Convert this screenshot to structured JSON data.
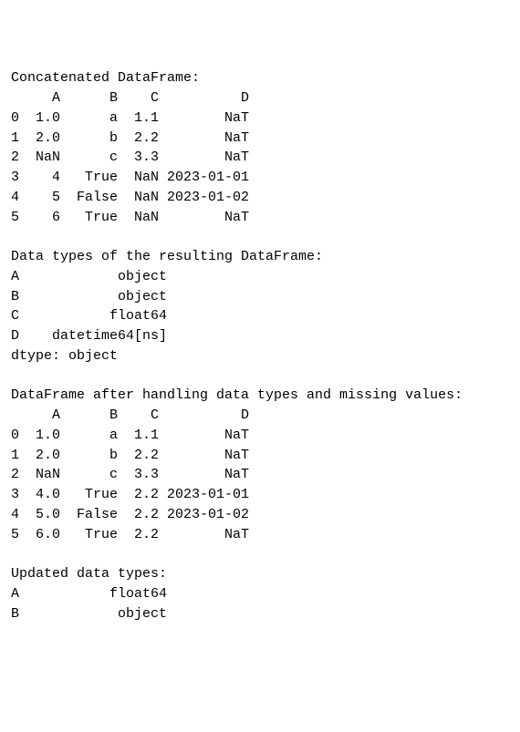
{
  "section1": {
    "title": "Concatenated DataFrame:",
    "header": "     A      B    C          D",
    "rows": [
      "0  1.0      a  1.1        NaT",
      "1  2.0      b  2.2        NaT",
      "2  NaN      c  3.3        NaT",
      "3    4   True  NaN 2023-01-01",
      "4    5  False  NaN 2023-01-02",
      "5    6   True  NaN        NaT"
    ]
  },
  "section2": {
    "title": "Data types of the resulting DataFrame:",
    "rows": [
      "A            object",
      "B            object",
      "C           float64",
      "D    datetime64[ns]",
      "dtype: object"
    ]
  },
  "section3": {
    "title": "DataFrame after handling data types and missing values:",
    "header": "     A      B    C          D",
    "rows": [
      "0  1.0      a  1.1        NaT",
      "1  2.0      b  2.2        NaT",
      "2  NaN      c  3.3        NaT",
      "3  4.0   True  2.2 2023-01-01",
      "4  5.0  False  2.2 2023-01-02",
      "5  6.0   True  2.2        NaT"
    ]
  },
  "section4": {
    "title": "Updated data types:",
    "rows": [
      "A           float64",
      "B            object"
    ]
  }
}
